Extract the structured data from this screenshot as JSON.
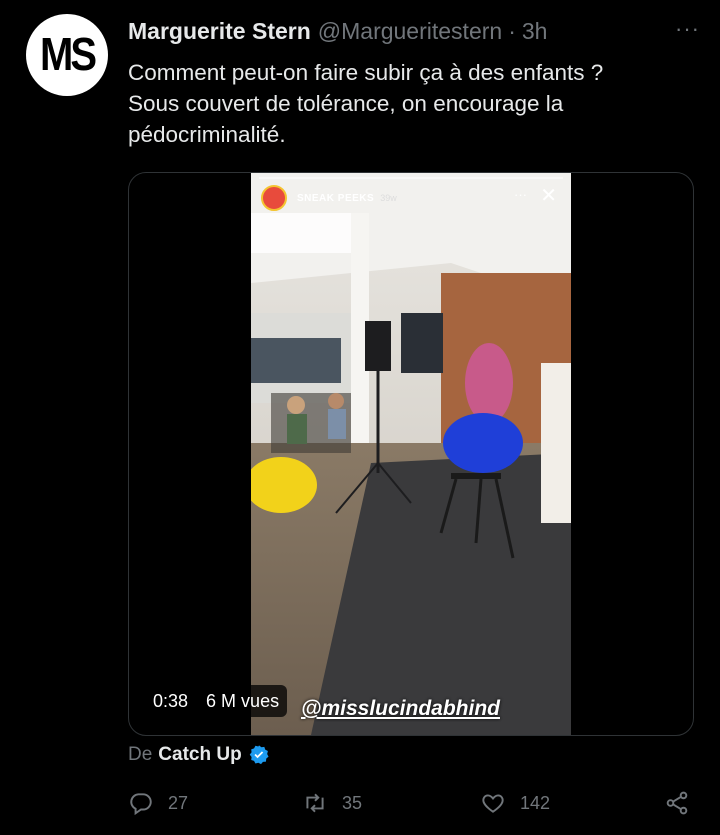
{
  "tweet": {
    "author": {
      "avatar_text": "MS",
      "name": "Marguerite Stern",
      "handle": "@Margueritestern",
      "separator": "·",
      "time": "3h"
    },
    "more_label": "···",
    "text": "Comment peut-on faire subir ça à des enfants ?\nSous couvert de tolérance, on encourage la\npédocriminalité.",
    "media": {
      "story_account": "SNEAK PEEKS",
      "story_age": "39w",
      "story_more": "···",
      "story_close": "✕",
      "overlay_tag": "@misslucindabhind",
      "duration": "0:38",
      "views": "6 M vues"
    },
    "source": {
      "prefix": "De",
      "name": "Catch Up",
      "verified": true
    },
    "actions": {
      "replies": "27",
      "retweets": "35",
      "likes": "142"
    }
  },
  "colors": {
    "background": "#000000",
    "text": "#e7e9ea",
    "muted": "#71767b",
    "verified": "#1d9bf0",
    "border": "#2f3336"
  },
  "icons": [
    "reply-icon",
    "retweet-icon",
    "like-icon",
    "share-icon",
    "verified-badge-icon"
  ]
}
